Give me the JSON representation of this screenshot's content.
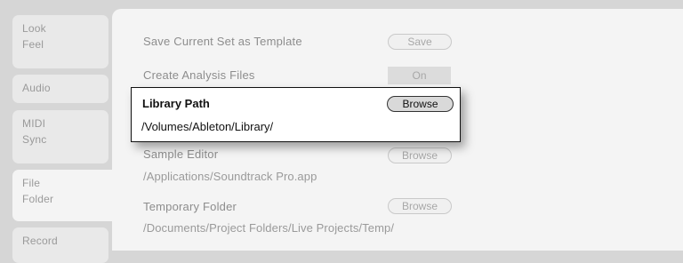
{
  "sidebar": {
    "tabs": [
      {
        "line1": "Look",
        "line2": "Feel"
      },
      {
        "line1": "Audio",
        "line2": ""
      },
      {
        "line1": "MIDI",
        "line2": "Sync"
      },
      {
        "line1": "File",
        "line2": "Folder"
      },
      {
        "line1": "Record",
        "line2": ""
      }
    ],
    "active_tab": "File Folder"
  },
  "settings": {
    "save_template": {
      "label": "Save Current Set as Template",
      "button": "Save"
    },
    "analysis_files": {
      "label": "Create Analysis Files",
      "toggle": "On"
    },
    "library_path": {
      "label": "Library Path",
      "path": "/Volumes/Ableton/Library/",
      "button": "Browse"
    },
    "sample_editor": {
      "label": "Sample Editor",
      "path": "/Applications/Soundtrack Pro.app",
      "button": "Browse"
    },
    "temp_folder": {
      "label": "Temporary Folder",
      "path": "/Documents/Project Folders/Live Projects/Temp/",
      "button": "Browse"
    }
  },
  "colors": {
    "background": "#d6d6d6",
    "panel": "#f4f4f4",
    "highlight_border": "#111111",
    "muted_text": "#8d8d8d"
  }
}
